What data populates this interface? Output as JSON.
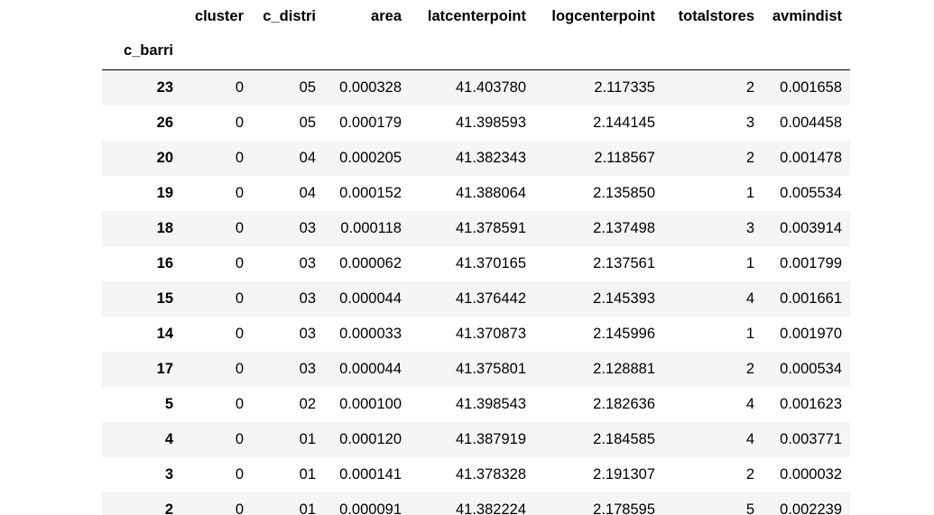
{
  "dataframe": {
    "index_name": "c_barri",
    "columns": [
      "cluster",
      "c_distri",
      "area",
      "latcenterpoint",
      "logcenterpoint",
      "totalstores",
      "avmindist"
    ],
    "rows": [
      {
        "index": "23",
        "cells": [
          "0",
          "05",
          "0.000328",
          "41.403780",
          "2.117335",
          "2",
          "0.001658"
        ]
      },
      {
        "index": "26",
        "cells": [
          "0",
          "05",
          "0.000179",
          "41.398593",
          "2.144145",
          "3",
          "0.004458"
        ]
      },
      {
        "index": "20",
        "cells": [
          "0",
          "04",
          "0.000205",
          "41.382343",
          "2.118567",
          "2",
          "0.001478"
        ]
      },
      {
        "index": "19",
        "cells": [
          "0",
          "04",
          "0.000152",
          "41.388064",
          "2.135850",
          "1",
          "0.005534"
        ]
      },
      {
        "index": "18",
        "cells": [
          "0",
          "03",
          "0.000118",
          "41.378591",
          "2.137498",
          "3",
          "0.003914"
        ]
      },
      {
        "index": "16",
        "cells": [
          "0",
          "03",
          "0.000062",
          "41.370165",
          "2.137561",
          "1",
          "0.001799"
        ]
      },
      {
        "index": "15",
        "cells": [
          "0",
          "03",
          "0.000044",
          "41.376442",
          "2.145393",
          "4",
          "0.001661"
        ]
      },
      {
        "index": "14",
        "cells": [
          "0",
          "03",
          "0.000033",
          "41.370873",
          "2.145996",
          "1",
          "0.001970"
        ]
      },
      {
        "index": "17",
        "cells": [
          "0",
          "03",
          "0.000044",
          "41.375801",
          "2.128881",
          "2",
          "0.000534"
        ]
      },
      {
        "index": "5",
        "cells": [
          "0",
          "02",
          "0.000100",
          "41.398543",
          "2.182636",
          "4",
          "0.001623"
        ]
      },
      {
        "index": "4",
        "cells": [
          "0",
          "01",
          "0.000120",
          "41.387919",
          "2.184585",
          "4",
          "0.003771"
        ]
      },
      {
        "index": "3",
        "cells": [
          "0",
          "01",
          "0.000141",
          "41.378328",
          "2.191307",
          "2",
          "0.000032"
        ]
      },
      {
        "index": "2",
        "cells": [
          "0",
          "01",
          "0.000091",
          "41.382224",
          "2.178595",
          "5",
          "0.002239"
        ]
      }
    ]
  },
  "colors": {
    "prompt_accent": "#e0691a",
    "row_stripe": "#f5f5f5",
    "header_rule": "#000000"
  }
}
